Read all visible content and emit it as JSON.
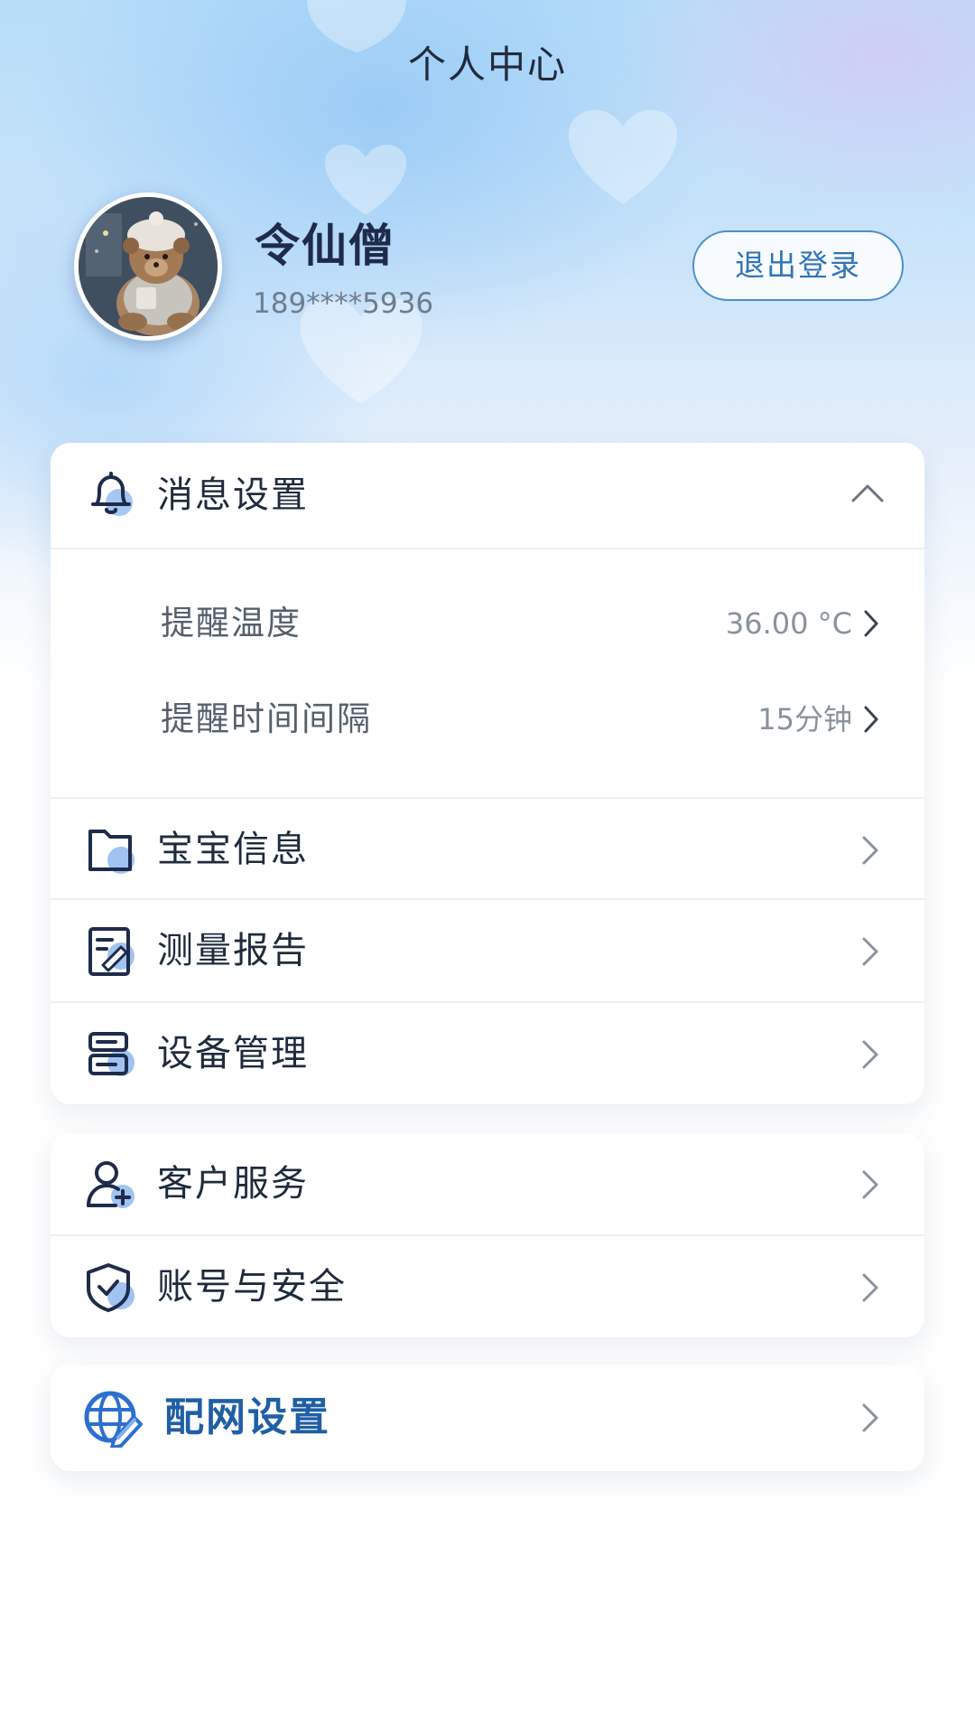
{
  "header": {
    "title": "个人中心"
  },
  "profile": {
    "name": "令仙僧",
    "phone": "189****5936",
    "logout_label": "退出登录"
  },
  "message_settings": {
    "label": "消息设置",
    "expanded": true,
    "items": [
      {
        "label": "提醒温度",
        "value": "36.00 °C"
      },
      {
        "label": "提醒时间间隔",
        "value": "15分钟"
      }
    ]
  },
  "menu_group_1": [
    {
      "label": "宝宝信息",
      "icon": "folder-icon"
    },
    {
      "label": "测量报告",
      "icon": "report-icon"
    },
    {
      "label": "设备管理",
      "icon": "device-icon"
    }
  ],
  "menu_group_2": [
    {
      "label": "客户服务",
      "icon": "user-add-icon"
    },
    {
      "label": "账号与安全",
      "icon": "shield-check-icon"
    }
  ],
  "network": {
    "label": "配网设置",
    "icon": "globe-edit-icon"
  },
  "colors": {
    "accent": "#1f5fa5",
    "icon_blue": "#4a8fe0",
    "text_primary": "#1f2b3d",
    "text_secondary": "#8a929c"
  }
}
